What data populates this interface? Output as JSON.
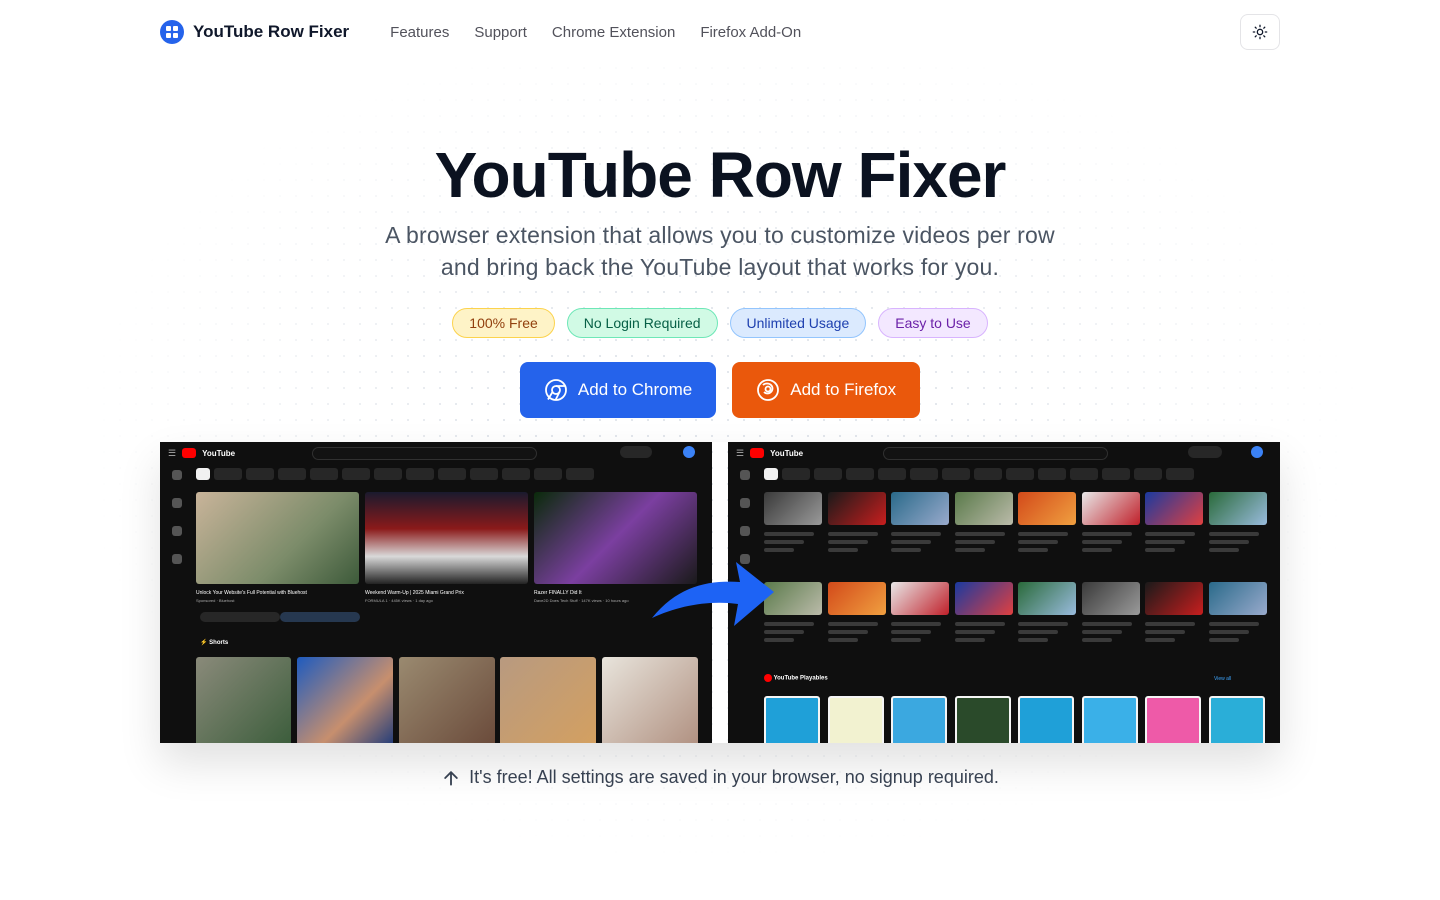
{
  "brand": {
    "name": "YouTube Row Fixer"
  },
  "nav": {
    "links": [
      "Features",
      "Support",
      "Chrome Extension",
      "Firefox Add-On"
    ]
  },
  "hero": {
    "title": "YouTube Row Fixer",
    "subtitle_line1": "A browser extension that allows you to customize videos per row",
    "subtitle_line2": "and bring back the YouTube layout that works for you."
  },
  "badges": [
    "100% Free",
    "No Login Required",
    "Unlimited Usage",
    "Easy to Use"
  ],
  "buttons": {
    "chrome": "Add to Chrome",
    "firefox": "Add to Firefox"
  },
  "screenshots": {
    "before": {
      "shorts_label": "Shorts",
      "videos": [
        {
          "title": "Unlock Your Website's Full Potential with Bluehost",
          "meta": "Sponsored · Bluehost"
        },
        {
          "title": "Weekend Warm-Up | 2025 Miami Grand Prix",
          "meta": "FORMULA 1 · 445K views · 1 day ago"
        },
        {
          "title": "Razer FINALLY Did It",
          "meta": "Dave2D Does Tech Stuff · 147K views · 10 hours ago"
        }
      ]
    },
    "after": {
      "section_label": "YouTube Playables",
      "view_all": "View all"
    }
  },
  "footnote": "It's free! All settings are saved in your browser, no signup required.",
  "colors": {
    "chrome": "#2563eb",
    "firefox": "#ea580c",
    "accent_arrow": "#1d63f5"
  }
}
